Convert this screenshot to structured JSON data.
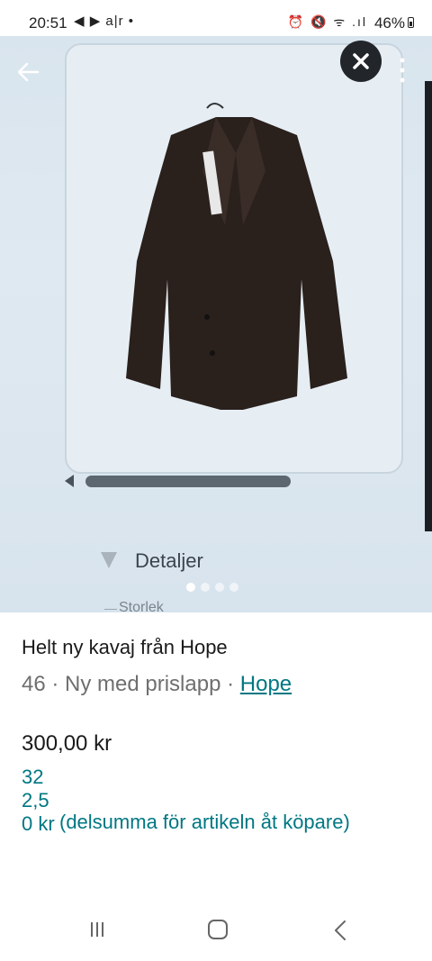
{
  "status_bar": {
    "time": "20:51",
    "left_icons": "◀ ▶ a|r •",
    "right_icons": "⏰ 🔇 ᯤ .ıl",
    "battery": "46%"
  },
  "photo": {
    "detaljer": "Detaljer",
    "storlek": "Storlek",
    "carousel": {
      "count": 4,
      "active_index": 0
    }
  },
  "item": {
    "title": "Helt ny kavaj från Hope",
    "meta_prefix": "46 · Ny med prislapp · ",
    "brand": "Hope",
    "price": "300,00 kr",
    "total_price": "322,50 kr",
    "total_note": "(delsumma för artikeln åt köpare)"
  },
  "icons": {
    "back": "arrow-left-icon",
    "close": "close-icon",
    "more": "more-vertical-icon",
    "nav_recent": "recent-apps-icon",
    "nav_home": "home-icon",
    "nav_back": "chevron-left-icon"
  },
  "colors": {
    "accent": "#007782",
    "text": "#1a1a1a",
    "muted": "#6f6f6f",
    "close_bg": "#22262b"
  }
}
